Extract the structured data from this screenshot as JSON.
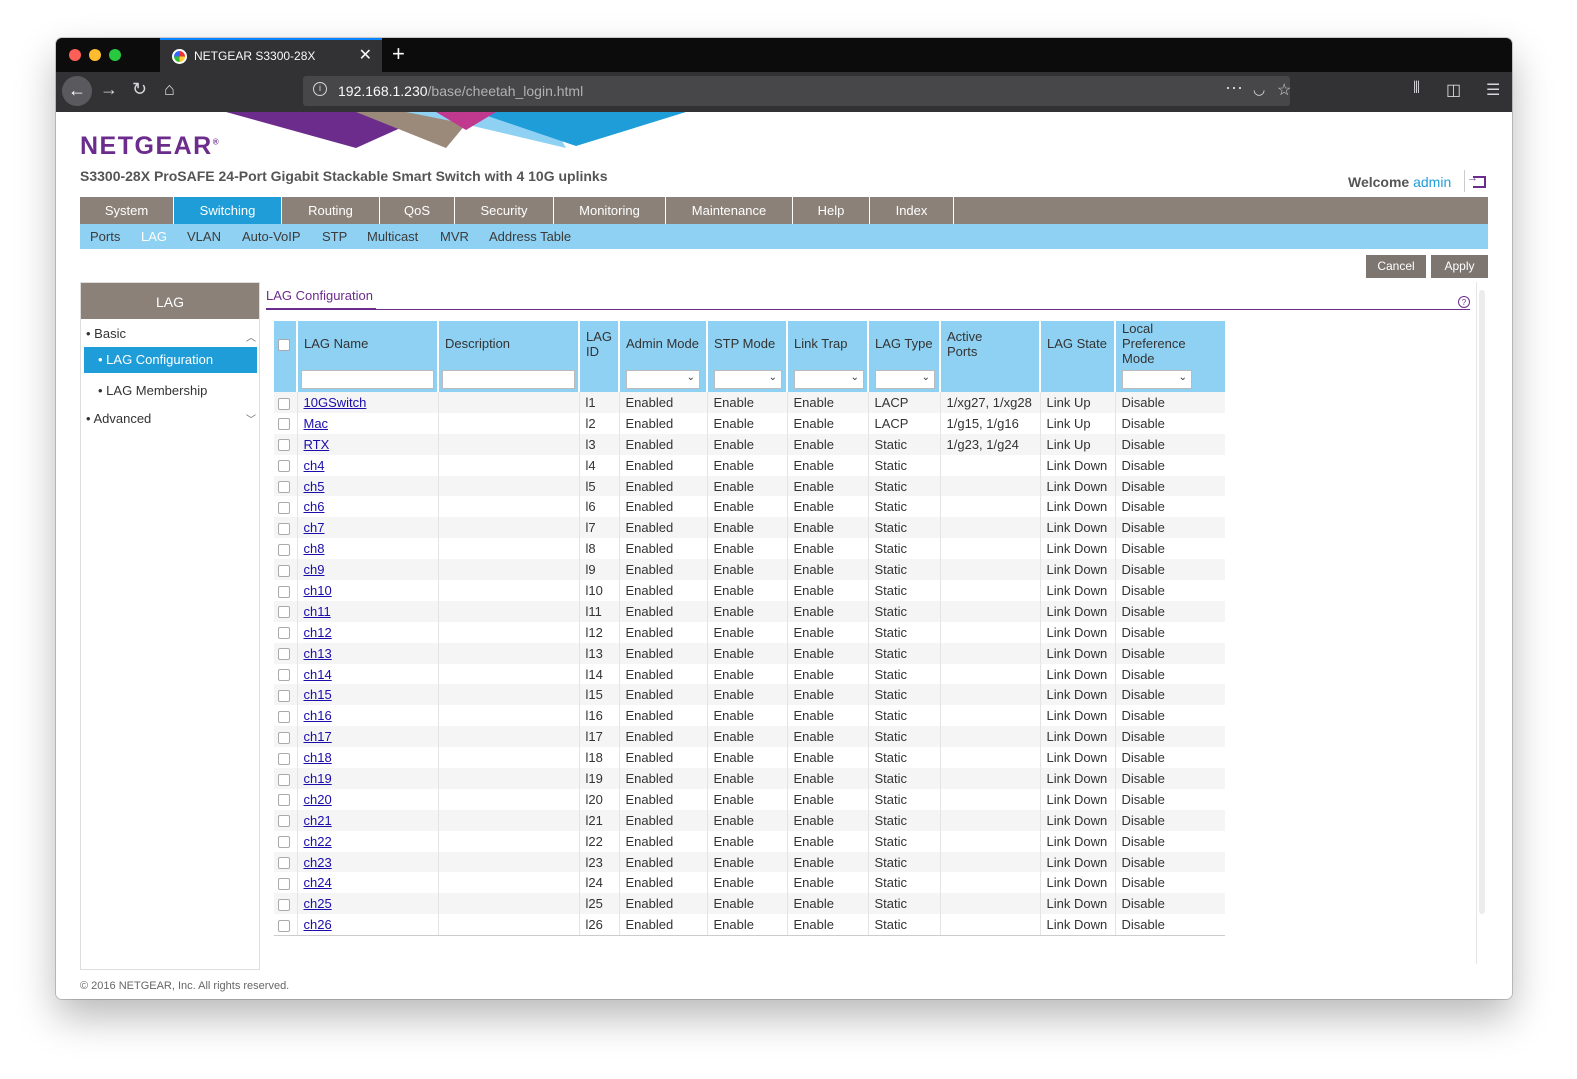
{
  "browser": {
    "tab_title": "NETGEAR S3300-28X",
    "close_glyph": "✕",
    "newtab_glyph": "+",
    "url_host": "192.168.1.230",
    "url_path": "/base/cheetah_login.html",
    "icons": [
      "back-icon",
      "forward-icon",
      "reload-icon",
      "home-icon",
      "info-icon",
      "more-icon",
      "pocket-icon",
      "bookmark-star-icon",
      "library-icon",
      "sidebar-icon",
      "menu-icon"
    ]
  },
  "header": {
    "logo": "NETGEAR",
    "logo_mark": "®",
    "product": "S3300-28X ProSAFE 24-Port Gigabit Stackable Smart Switch with 4 10G uplinks",
    "welcome": "Welcome",
    "user": "admin"
  },
  "main_menu": [
    {
      "label": "System",
      "active": false
    },
    {
      "label": "Switching",
      "active": true
    },
    {
      "label": "Routing",
      "active": false
    },
    {
      "label": "QoS",
      "active": false
    },
    {
      "label": "Security",
      "active": false
    },
    {
      "label": "Monitoring",
      "active": false
    },
    {
      "label": "Maintenance",
      "active": false
    },
    {
      "label": "Help",
      "active": false
    },
    {
      "label": "Index",
      "active": false
    }
  ],
  "sub_menu": [
    {
      "label": "Ports",
      "active": false
    },
    {
      "label": "LAG",
      "active": true
    },
    {
      "label": "VLAN",
      "active": false
    },
    {
      "label": "Auto-VoIP",
      "active": false
    },
    {
      "label": "STP",
      "active": false
    },
    {
      "label": "Multicast",
      "active": false
    },
    {
      "label": "MVR",
      "active": false
    },
    {
      "label": "Address Table",
      "active": false
    }
  ],
  "buttons": {
    "cancel": "Cancel",
    "apply": "Apply"
  },
  "sidebar": {
    "title": "LAG",
    "basic": "Basic",
    "lag_configuration": "LAG Configuration",
    "lag_membership": "LAG Membership",
    "advanced": "Advanced"
  },
  "content": {
    "tab": "LAG Configuration",
    "help": "?"
  },
  "table": {
    "headers": {
      "name": "LAG Name",
      "description": "Description",
      "id_1": "LAG",
      "id_2": "ID",
      "admin_mode": "Admin Mode",
      "stp_mode": "STP Mode",
      "link_trap": "Link Trap",
      "lag_type": "LAG Type",
      "active_ports_1": "Active",
      "active_ports_2": "Ports",
      "lag_state": "LAG State",
      "local_pref_1": "Local Preference",
      "local_pref_2": "Mode"
    },
    "rows": [
      {
        "name": "10GSwitch",
        "id": "l1",
        "admin": "Enabled",
        "stp": "Enable",
        "trap": "Enable",
        "type": "LACP",
        "ports": "1/xg27, 1/xg28",
        "state": "Link Up",
        "pref": "Disable"
      },
      {
        "name": "Mac",
        "id": "l2",
        "admin": "Enabled",
        "stp": "Enable",
        "trap": "Enable",
        "type": "LACP",
        "ports": "1/g15, 1/g16",
        "state": "Link Up",
        "pref": "Disable"
      },
      {
        "name": "RTX",
        "id": "l3",
        "admin": "Enabled",
        "stp": "Enable",
        "trap": "Enable",
        "type": "Static",
        "ports": "1/g23, 1/g24",
        "state": "Link Up",
        "pref": "Disable"
      },
      {
        "name": "ch4",
        "id": "l4",
        "admin": "Enabled",
        "stp": "Enable",
        "trap": "Enable",
        "type": "Static",
        "ports": "",
        "state": "Link Down",
        "pref": "Disable"
      },
      {
        "name": "ch5",
        "id": "l5",
        "admin": "Enabled",
        "stp": "Enable",
        "trap": "Enable",
        "type": "Static",
        "ports": "",
        "state": "Link Down",
        "pref": "Disable"
      },
      {
        "name": "ch6",
        "id": "l6",
        "admin": "Enabled",
        "stp": "Enable",
        "trap": "Enable",
        "type": "Static",
        "ports": "",
        "state": "Link Down",
        "pref": "Disable"
      },
      {
        "name": "ch7",
        "id": "l7",
        "admin": "Enabled",
        "stp": "Enable",
        "trap": "Enable",
        "type": "Static",
        "ports": "",
        "state": "Link Down",
        "pref": "Disable"
      },
      {
        "name": "ch8",
        "id": "l8",
        "admin": "Enabled",
        "stp": "Enable",
        "trap": "Enable",
        "type": "Static",
        "ports": "",
        "state": "Link Down",
        "pref": "Disable"
      },
      {
        "name": "ch9",
        "id": "l9",
        "admin": "Enabled",
        "stp": "Enable",
        "trap": "Enable",
        "type": "Static",
        "ports": "",
        "state": "Link Down",
        "pref": "Disable"
      },
      {
        "name": "ch10",
        "id": "l10",
        "admin": "Enabled",
        "stp": "Enable",
        "trap": "Enable",
        "type": "Static",
        "ports": "",
        "state": "Link Down",
        "pref": "Disable"
      },
      {
        "name": "ch11",
        "id": "l11",
        "admin": "Enabled",
        "stp": "Enable",
        "trap": "Enable",
        "type": "Static",
        "ports": "",
        "state": "Link Down",
        "pref": "Disable"
      },
      {
        "name": "ch12",
        "id": "l12",
        "admin": "Enabled",
        "stp": "Enable",
        "trap": "Enable",
        "type": "Static",
        "ports": "",
        "state": "Link Down",
        "pref": "Disable"
      },
      {
        "name": "ch13",
        "id": "l13",
        "admin": "Enabled",
        "stp": "Enable",
        "trap": "Enable",
        "type": "Static",
        "ports": "",
        "state": "Link Down",
        "pref": "Disable"
      },
      {
        "name": "ch14",
        "id": "l14",
        "admin": "Enabled",
        "stp": "Enable",
        "trap": "Enable",
        "type": "Static",
        "ports": "",
        "state": "Link Down",
        "pref": "Disable"
      },
      {
        "name": "ch15",
        "id": "l15",
        "admin": "Enabled",
        "stp": "Enable",
        "trap": "Enable",
        "type": "Static",
        "ports": "",
        "state": "Link Down",
        "pref": "Disable"
      },
      {
        "name": "ch16",
        "id": "l16",
        "admin": "Enabled",
        "stp": "Enable",
        "trap": "Enable",
        "type": "Static",
        "ports": "",
        "state": "Link Down",
        "pref": "Disable"
      },
      {
        "name": "ch17",
        "id": "l17",
        "admin": "Enabled",
        "stp": "Enable",
        "trap": "Enable",
        "type": "Static",
        "ports": "",
        "state": "Link Down",
        "pref": "Disable"
      },
      {
        "name": "ch18",
        "id": "l18",
        "admin": "Enabled",
        "stp": "Enable",
        "trap": "Enable",
        "type": "Static",
        "ports": "",
        "state": "Link Down",
        "pref": "Disable"
      },
      {
        "name": "ch19",
        "id": "l19",
        "admin": "Enabled",
        "stp": "Enable",
        "trap": "Enable",
        "type": "Static",
        "ports": "",
        "state": "Link Down",
        "pref": "Disable"
      },
      {
        "name": "ch20",
        "id": "l20",
        "admin": "Enabled",
        "stp": "Enable",
        "trap": "Enable",
        "type": "Static",
        "ports": "",
        "state": "Link Down",
        "pref": "Disable"
      },
      {
        "name": "ch21",
        "id": "l21",
        "admin": "Enabled",
        "stp": "Enable",
        "trap": "Enable",
        "type": "Static",
        "ports": "",
        "state": "Link Down",
        "pref": "Disable"
      },
      {
        "name": "ch22",
        "id": "l22",
        "admin": "Enabled",
        "stp": "Enable",
        "trap": "Enable",
        "type": "Static",
        "ports": "",
        "state": "Link Down",
        "pref": "Disable"
      },
      {
        "name": "ch23",
        "id": "l23",
        "admin": "Enabled",
        "stp": "Enable",
        "trap": "Enable",
        "type": "Static",
        "ports": "",
        "state": "Link Down",
        "pref": "Disable"
      },
      {
        "name": "ch24",
        "id": "l24",
        "admin": "Enabled",
        "stp": "Enable",
        "trap": "Enable",
        "type": "Static",
        "ports": "",
        "state": "Link Down",
        "pref": "Disable"
      },
      {
        "name": "ch25",
        "id": "l25",
        "admin": "Enabled",
        "stp": "Enable",
        "trap": "Enable",
        "type": "Static",
        "ports": "",
        "state": "Link Down",
        "pref": "Disable"
      },
      {
        "name": "ch26",
        "id": "l26",
        "admin": "Enabled",
        "stp": "Enable",
        "trap": "Enable",
        "type": "Static",
        "ports": "",
        "state": "Link Down",
        "pref": "Disable"
      }
    ]
  },
  "footer": {
    "copyright": "© 2016 NETGEAR, Inc. All rights reserved."
  },
  "colors": {
    "brand_purple": "#6c2c8c",
    "active_blue": "#1e9dd8",
    "menu_gray": "#8b8178",
    "light_blue": "#8fd1f3"
  }
}
